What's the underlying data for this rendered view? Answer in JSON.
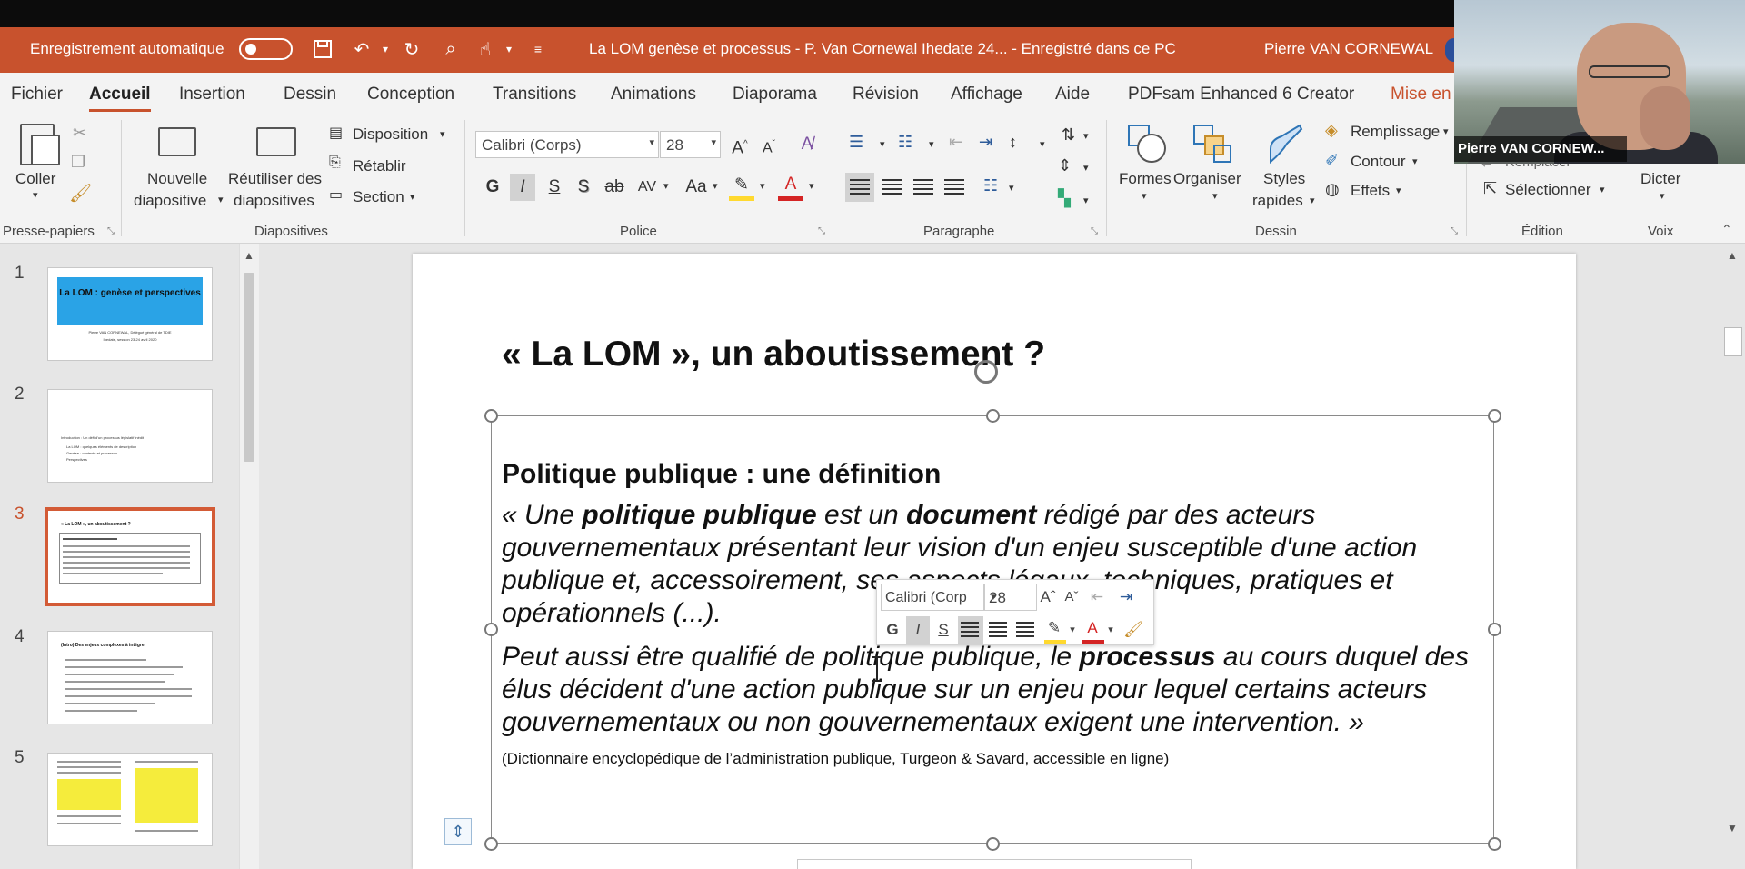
{
  "titlebar": {
    "autosave_label": "Enregistrement automatique",
    "autosave_state": "off",
    "doc_title": "La LOM genèse et processus - P. Van Cornewal Ihedate 24...  -  Enregistré dans ce PC",
    "user_name": "Pierre VAN CORNEWAL"
  },
  "menu": {
    "tabs": [
      "Fichier",
      "Accueil",
      "Insertion",
      "Dessin",
      "Conception",
      "Transitions",
      "Animations",
      "Diaporama",
      "Révision",
      "Affichage",
      "Aide",
      "PDFsam Enhanced 6 Creator",
      "Mise en"
    ],
    "active": "Accueil"
  },
  "ribbon": {
    "clipboard": {
      "paste": "Coller",
      "group": "Presse-papiers"
    },
    "slides": {
      "new_line1": "Nouvelle",
      "new_line2": "diapositive",
      "reuse_line1": "Réutiliser des",
      "reuse_line2": "diapositives",
      "layout": "Disposition",
      "reset": "Rétablir",
      "section": "Section",
      "group": "Diapositives"
    },
    "font": {
      "name": "Calibri (Corps)",
      "size": "28",
      "bold": "G",
      "italic": "I",
      "underline": "S",
      "shadow": "S",
      "strike": "ab",
      "spacing": "AV",
      "case": "Aa",
      "grow": "A",
      "shrink": "A",
      "color_letter": "A",
      "highlight_color": "#ffd92f",
      "font_color": "#d42424",
      "group": "Police"
    },
    "paragraph": {
      "group": "Paragraphe"
    },
    "drawing": {
      "shapes": "Formes",
      "arrange": "Organiser",
      "styles_line1": "Styles",
      "styles_line2": "rapides",
      "fill": "Remplissage",
      "outline": "Contour",
      "effects": "Effets",
      "group": "Dessin"
    },
    "editing": {
      "replace": "Remplacer",
      "select": "Sélectionner",
      "group": "Édition"
    },
    "voice": {
      "dictate": "Dicter",
      "group": "Voix"
    }
  },
  "webcam": {
    "name_label": "Pierre VAN CORNEW..."
  },
  "thumbnails": [
    {
      "number": "1",
      "title": "La LOM : genèse et perspectives",
      "author": "Pierre VAN CORNEWAL, Délégué général de TDIE",
      "session": "Ihedate, session 23-24 avril 2020"
    },
    {
      "number": "2",
      "title": "Introduction : Un défi d'un processus législatif inédit",
      "items": [
        "La LOM : quelques éléments de description",
        "Genèse : contexte et processus",
        "Perspectives"
      ]
    },
    {
      "number": "3",
      "title": "« La LOM », un aboutissement ?",
      "selected": true
    },
    {
      "number": "4",
      "title": "(Intro) Des enjeux complexes à intégrer"
    },
    {
      "number": "5",
      "title": ""
    }
  ],
  "slide": {
    "title": "« La LOM », un aboutissement ?",
    "heading": "Politique publique : une définition",
    "para1": [
      {
        "t": "« Une ",
        "b": false
      },
      {
        "t": "politique publique",
        "b": true
      },
      {
        "t": " est un ",
        "b": false
      },
      {
        "t": "document",
        "b": true
      },
      {
        "t": " rédigé par des acteurs gouvernementaux présentant leur vision d'un enjeu susceptible d'une action publique et, accessoirement, ses aspects légaux, techniques, pratiques et opérationnels (...).",
        "b": false
      }
    ],
    "para2": [
      {
        "t": "Peut aussi être qualifié de politique publique, le ",
        "b": false
      },
      {
        "t": "processus",
        "b": true
      },
      {
        "t": " au cours duquel des élus décident d'une action publique sur un enjeu pour lequel certains acteurs gouvernementaux ou non gouvernementaux exigent une intervention. »",
        "b": false
      }
    ],
    "source": "(Dictionnaire encyclopédique de l’administration publique, Turgeon & Savard, accessible en ligne)"
  },
  "mini_toolbar": {
    "font": "Calibri (Corp",
    "size": "28",
    "bold": "G",
    "italic": "I",
    "underline": "S"
  }
}
